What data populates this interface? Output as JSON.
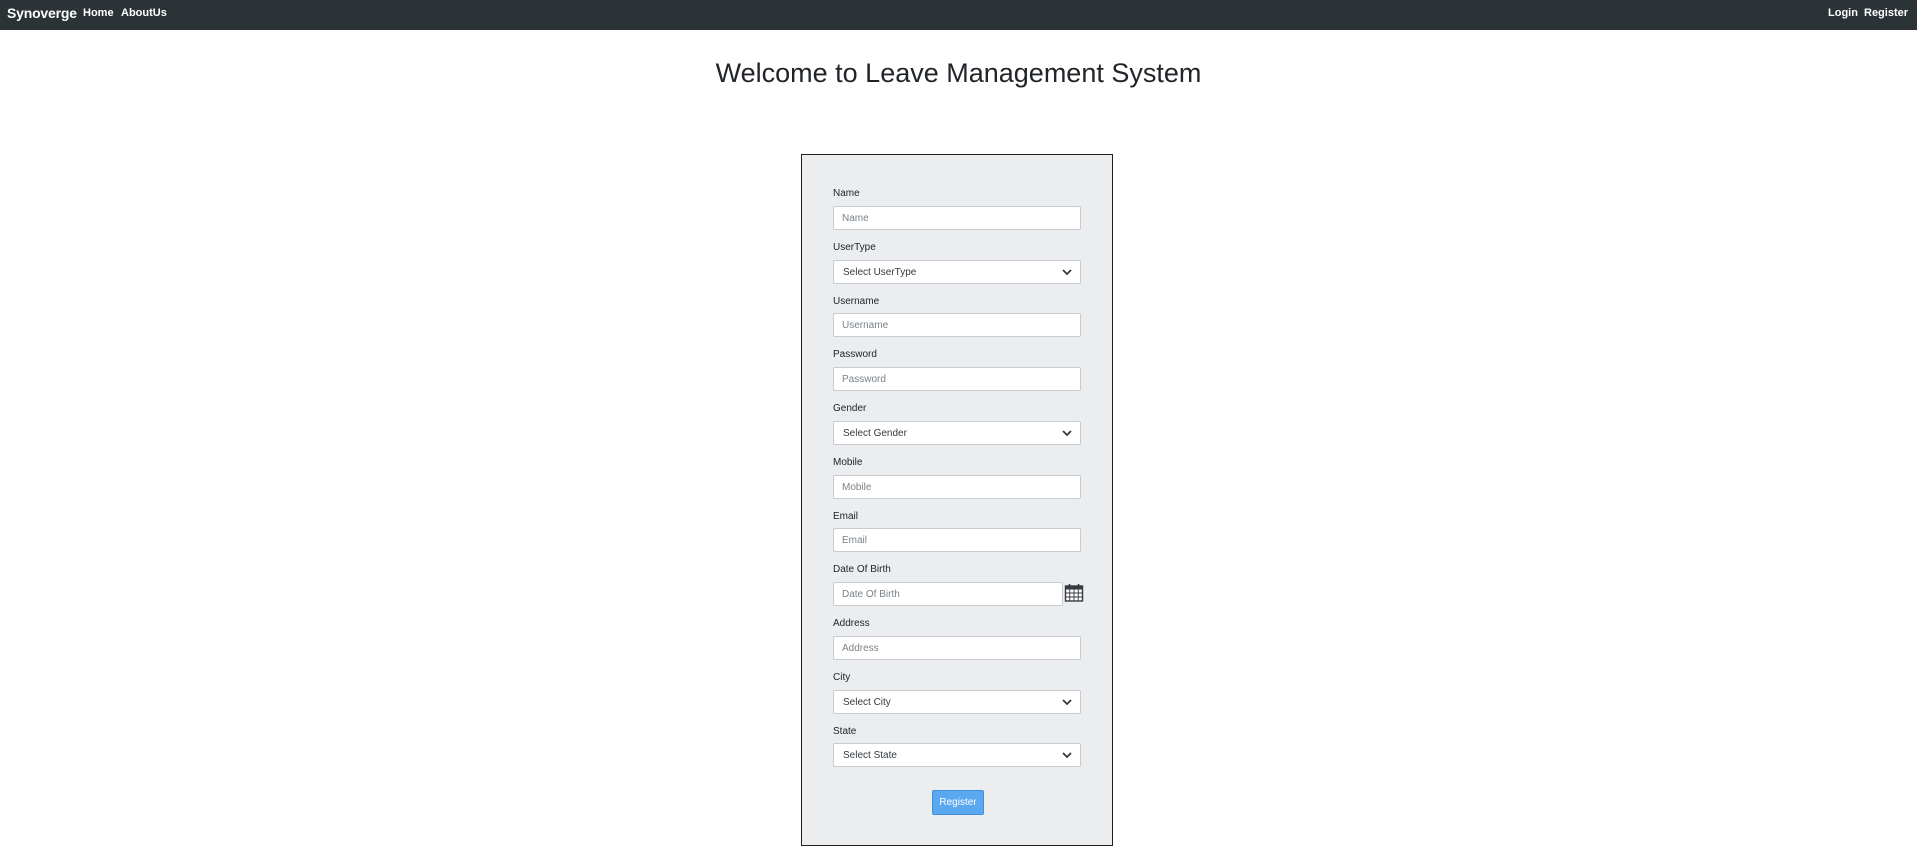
{
  "navbar": {
    "brand": "Synoverge",
    "links": {
      "home": "Home",
      "about": "AboutUs"
    },
    "right_links": {
      "login": "Login",
      "register": "Register"
    }
  },
  "page": {
    "title": "Welcome to Leave Management System"
  },
  "form": {
    "name": {
      "label": "Name",
      "placeholder": "Name"
    },
    "usertype": {
      "label": "UserType",
      "value": "Select UserType"
    },
    "username": {
      "label": "Username",
      "placeholder": "Username"
    },
    "password": {
      "label": "Password",
      "placeholder": "Password"
    },
    "gender": {
      "label": "Gender",
      "value": "Select Gender"
    },
    "mobile": {
      "label": "Mobile",
      "placeholder": "Mobile"
    },
    "email": {
      "label": "Email",
      "placeholder": "Email"
    },
    "dob": {
      "label": "Date Of Birth",
      "placeholder": "Date Of Birth",
      "icon": "calendar-icon"
    },
    "address": {
      "label": "Address",
      "placeholder": "Address"
    },
    "city": {
      "label": "City",
      "value": "Select City"
    },
    "state": {
      "label": "State",
      "value": "Select State"
    },
    "submit_label": "Register"
  },
  "colors": {
    "navbar_bg": "#2b3336",
    "card_bg": "#ebedef",
    "button_bg": "#5aa9f0"
  }
}
